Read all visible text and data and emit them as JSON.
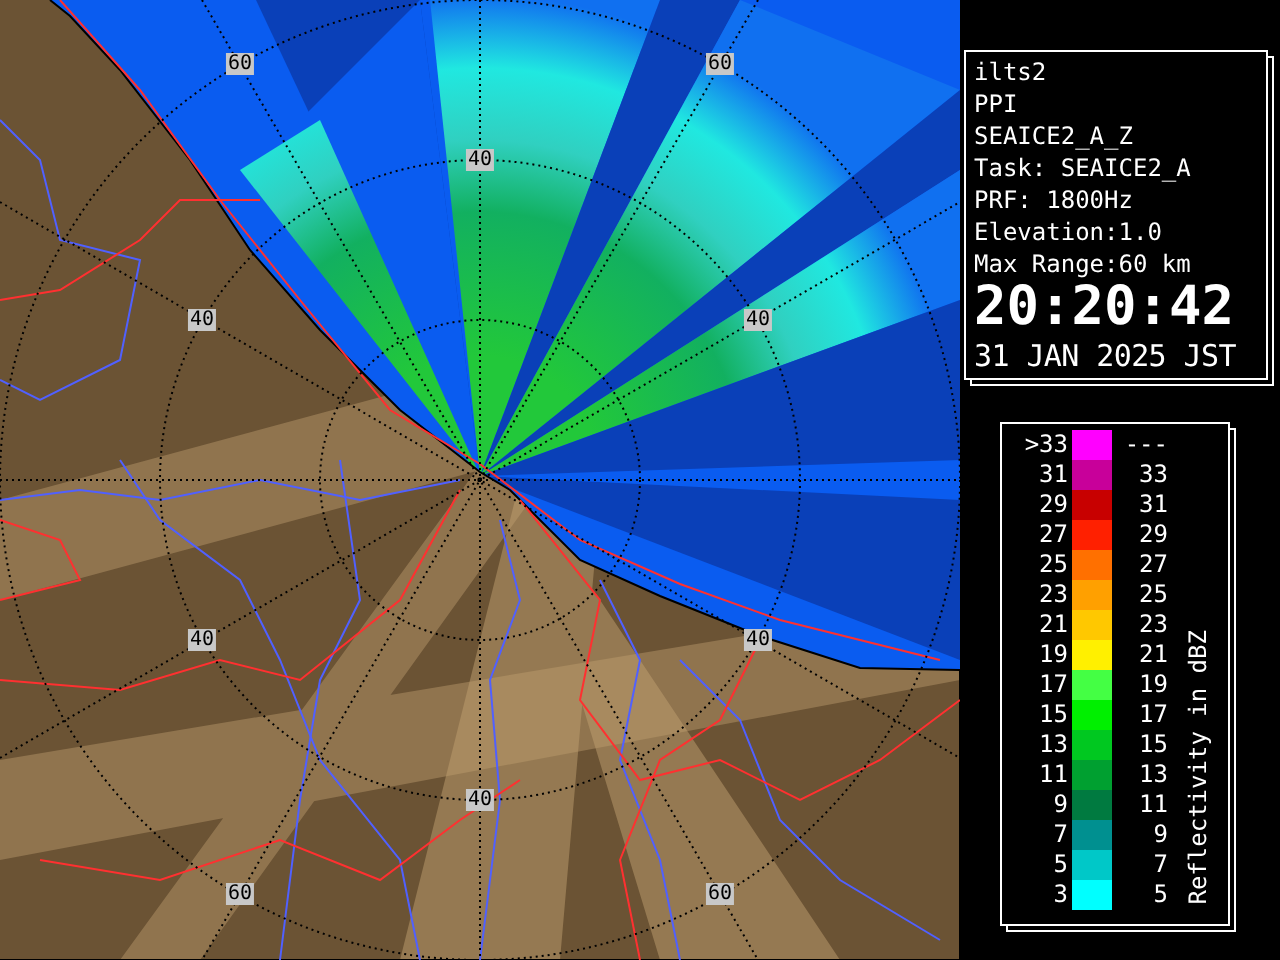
{
  "map": {
    "range_labels": [
      {
        "text": "60"
      },
      {
        "text": "60"
      },
      {
        "text": "40"
      },
      {
        "text": "40"
      },
      {
        "text": "40"
      },
      {
        "text": "40"
      },
      {
        "text": "40"
      },
      {
        "text": "40"
      },
      {
        "text": "60"
      },
      {
        "text": "60"
      }
    ]
  },
  "info": {
    "lines": [
      "ilts2",
      "PPI",
      "SEAICE2_A_Z",
      "Task: SEAICE2_A",
      "PRF: 1800Hz",
      "Elevation:1.0",
      "Max Range:60 km"
    ],
    "time": "20:20:42",
    "date": "31 JAN 2025 JST"
  },
  "legend": {
    "title": "Reflectivity in dBZ",
    "rows": [
      {
        "low": ">33",
        "high": "---",
        "color": "#ff00ff"
      },
      {
        "low": "31",
        "high": "33",
        "color": "#c8009a"
      },
      {
        "low": "29",
        "high": "31",
        "color": "#c80000"
      },
      {
        "low": "27",
        "high": "29",
        "color": "#ff2000"
      },
      {
        "low": "25",
        "high": "27",
        "color": "#ff7000"
      },
      {
        "low": "23",
        "high": "25",
        "color": "#ffa000"
      },
      {
        "low": "21",
        "high": "23",
        "color": "#ffc800"
      },
      {
        "low": "19",
        "high": "21",
        "color": "#fff000"
      },
      {
        "low": "17",
        "high": "19",
        "color": "#44ff44"
      },
      {
        "low": "15",
        "high": "17",
        "color": "#00f000"
      },
      {
        "low": "13",
        "high": "15",
        "color": "#00c820"
      },
      {
        "low": "11",
        "high": "13",
        "color": "#00a030"
      },
      {
        "low": "9",
        "high": "11",
        "color": "#007a40"
      },
      {
        "low": "7",
        "high": "9",
        "color": "#009090"
      },
      {
        "low": "5",
        "high": "7",
        "color": "#00c8c8"
      },
      {
        "low": "3",
        "high": "5",
        "color": "#00ffff"
      }
    ]
  }
}
